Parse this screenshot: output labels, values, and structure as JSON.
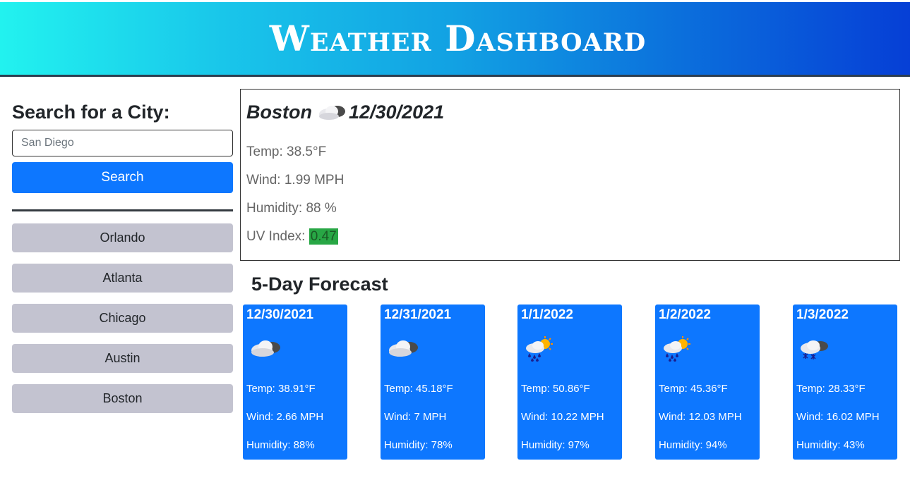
{
  "header": {
    "title": "Weather Dashboard"
  },
  "search": {
    "heading": "Search for a City:",
    "placeholder": "San Diego",
    "button_label": "Search"
  },
  "history": [
    "Orlando",
    "Atlanta",
    "Chicago",
    "Austin",
    "Boston"
  ],
  "current": {
    "city": "Boston",
    "date": "12/30/2021",
    "icon": "cloud-icon",
    "temp": "Temp: 38.5°F",
    "wind": "Wind: 1.99 MPH",
    "humidity": "Humidity: 88 %",
    "uv_label": "UV Index: ",
    "uv_value": "0.47",
    "uv_color": "#28a745"
  },
  "forecast": {
    "heading": "5-Day Forecast",
    "days": [
      {
        "date": "12/30/2021",
        "icon": "cloud-icon",
        "temp": "Temp: 38.91°F",
        "wind": "Wind: 2.66 MPH",
        "humidity": "Humidity: 88%"
      },
      {
        "date": "12/31/2021",
        "icon": "cloud-icon",
        "temp": "Temp: 45.18°F",
        "wind": "Wind: 7 MPH",
        "humidity": "Humidity: 78%"
      },
      {
        "date": "1/1/2022",
        "icon": "sun-rain-icon",
        "temp": "Temp: 50.86°F",
        "wind": "Wind: 10.22 MPH",
        "humidity": "Humidity: 97%"
      },
      {
        "date": "1/2/2022",
        "icon": "sun-rain-icon",
        "temp": "Temp: 45.36°F",
        "wind": "Wind: 12.03 MPH",
        "humidity": "Humidity: 94%"
      },
      {
        "date": "1/3/2022",
        "icon": "snow-icon",
        "temp": "Temp: 28.33°F",
        "wind": "Wind: 16.02 MPH",
        "humidity": "Humidity: 43%"
      }
    ]
  },
  "colors": {
    "accent": "#0d77ff",
    "history_button": "#c3c3d0",
    "uv_low": "#28a745"
  }
}
